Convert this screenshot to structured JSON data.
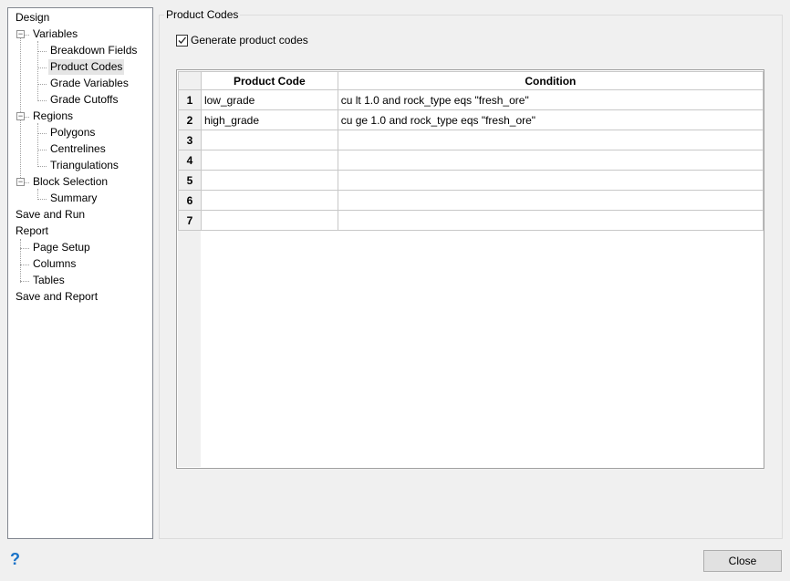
{
  "tree": {
    "items": [
      {
        "label": "Design",
        "level": 0
      },
      {
        "label": "Variables",
        "level": 1,
        "expander": "−"
      },
      {
        "label": "Breakdown Fields",
        "level": 2
      },
      {
        "label": "Product Codes",
        "level": 2,
        "selected": true
      },
      {
        "label": "Grade Variables",
        "level": 2
      },
      {
        "label": "Grade Cutoffs",
        "level": 2
      },
      {
        "label": "Regions",
        "level": 1,
        "expander": "−"
      },
      {
        "label": "Polygons",
        "level": 2
      },
      {
        "label": "Centrelines",
        "level": 2
      },
      {
        "label": "Triangulations",
        "level": 2
      },
      {
        "label": "Block Selection",
        "level": 1,
        "expander": "−"
      },
      {
        "label": "Summary",
        "level": 2
      },
      {
        "label": "Save and Run",
        "level": 0
      },
      {
        "label": "Report",
        "level": 0
      },
      {
        "label": "Page Setup",
        "level": 1
      },
      {
        "label": "Columns",
        "level": 1
      },
      {
        "label": "Tables",
        "level": 1
      },
      {
        "label": "Save and Report",
        "level": 0
      }
    ]
  },
  "panel": {
    "title": "Product Codes",
    "checkbox_label": "Generate product codes",
    "checkbox_checked": true
  },
  "grid": {
    "headers": [
      "Product Code",
      "Condition"
    ],
    "rows": [
      {
        "num": "1",
        "code": "low_grade",
        "condition": "cu lt 1.0 and rock_type eqs \"fresh_ore\""
      },
      {
        "num": "2",
        "code": "high_grade",
        "condition": "cu ge 1.0 and rock_type eqs \"fresh_ore\""
      },
      {
        "num": "3",
        "code": "",
        "condition": ""
      },
      {
        "num": "4",
        "code": "",
        "condition": ""
      },
      {
        "num": "5",
        "code": "",
        "condition": ""
      },
      {
        "num": "6",
        "code": "",
        "condition": ""
      },
      {
        "num": "7",
        "code": "",
        "condition": ""
      }
    ]
  },
  "footer": {
    "help": "?",
    "close_label": "Close"
  }
}
